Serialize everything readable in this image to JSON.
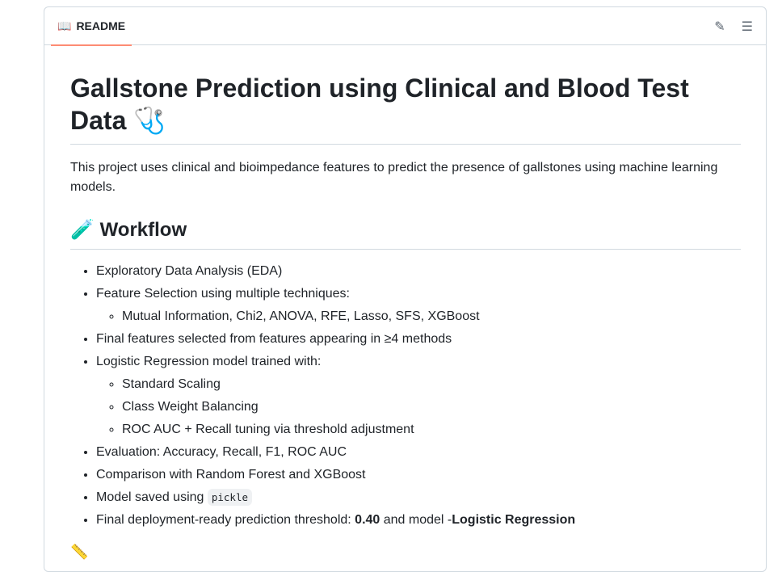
{
  "header": {
    "tab_label": "README",
    "tab_icon": "book-icon",
    "edit_icon": "pencil-icon",
    "toc_icon": "list-icon"
  },
  "readme": {
    "title": "Gallstone Prediction using Clinical and Blood Test Data",
    "title_emoji": "🩺",
    "intro": "This project uses clinical and bioimpedance features to predict the presence of gallstones using machine learning models.",
    "workflow_emoji": "🧪",
    "workflow_heading": "Workflow",
    "items": [
      {
        "text": "Exploratory Data Analysis (EDA)"
      },
      {
        "text": "Feature Selection using multiple techniques:",
        "sub": [
          "Mutual Information, Chi2, ANOVA, RFE, Lasso, SFS, XGBoost"
        ]
      },
      {
        "text": "Final features selected from features appearing in ≥4 methods"
      },
      {
        "text": "Logistic Regression model trained with:",
        "sub": [
          "Standard Scaling",
          "Class Weight Balancing",
          "ROC AUC + Recall tuning via threshold adjustment"
        ]
      },
      {
        "text": "Evaluation: Accuracy, Recall, F1, ROC AUC"
      },
      {
        "text": "Comparison with Random Forest and XGBoost"
      },
      {
        "text": "Model saved using ",
        "code": "pickle"
      },
      {
        "text": "Final deployment-ready prediction threshold: ",
        "bold1": "0.40",
        "mid": " and model -",
        "bold2": "Logistic Regression"
      }
    ],
    "next_emoji": "📏"
  }
}
